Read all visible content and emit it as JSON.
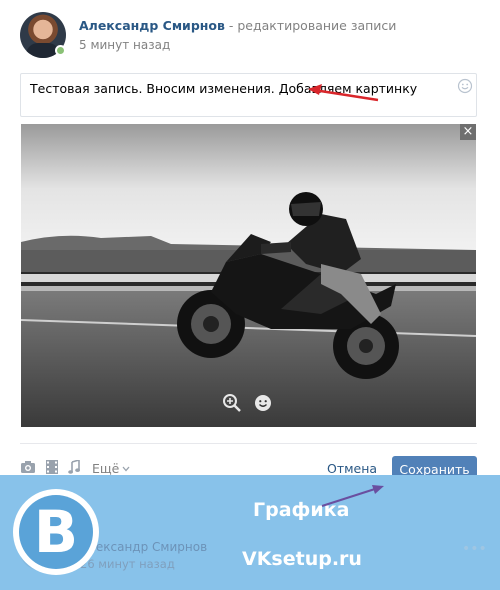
{
  "post_editor": {
    "author_name": "Александр Смирнов",
    "action_text": " - редактирование записи",
    "time": "5 минут назад",
    "text_value": "Тестовая запись. Вносим изменения. Добавляем картинку",
    "photo_close": "×"
  },
  "toolbar": {
    "more_label": "Ещё",
    "cancel_label": "Отмена",
    "save_label": "Сохранить"
  },
  "watermark": {
    "logo_letter": "B",
    "title": "Графика",
    "site": "VKsetup.ru"
  },
  "background_post": {
    "author_name": "Александр Смирнов",
    "time": "26 минут назад",
    "dots": "•••"
  },
  "colors": {
    "link": "#2a5885",
    "button": "#5181b8",
    "muted": "#828282",
    "watermark_bg": "#88c2ea",
    "annotation_arrow": "#d9262b"
  },
  "icons": [
    "smile-icon",
    "zoom-icon",
    "emoji-icon",
    "camera-icon",
    "film-icon",
    "music-icon",
    "chevron-down-icon",
    "close-icon",
    "arrow-annotation"
  ]
}
